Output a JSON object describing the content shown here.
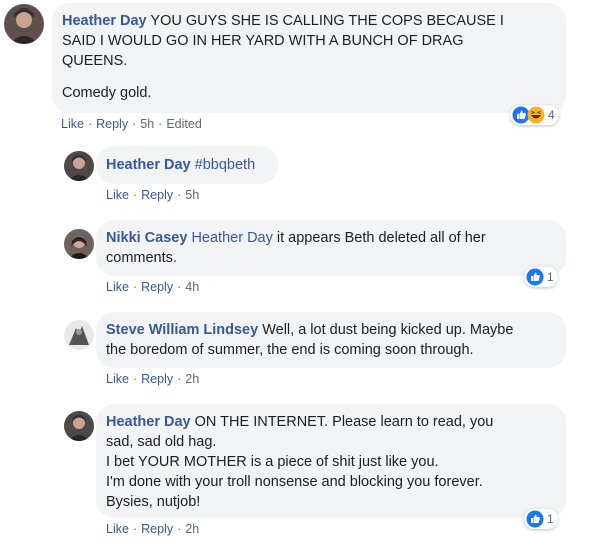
{
  "comments": [
    {
      "author": "Heather Day",
      "text_lines": [
        "YOU GUYS SHE IS CALLING THE COPS BECAUSE I",
        "SAID I WOULD GO IN HER YARD WITH A BUNCH OF DRAG",
        "QUEENS."
      ],
      "text2": "Comedy gold.",
      "like": "Like",
      "reply": "Reply",
      "time": "5h",
      "edited": "Edited",
      "reaction_count": "4"
    },
    {
      "author": "Heather Day",
      "hashtag": "#bbqbeth",
      "like": "Like",
      "reply": "Reply",
      "time": "5h"
    },
    {
      "author": "Nikki Casey",
      "mention": "Heather Day",
      "text_line1": "it appears Beth deleted all of her",
      "text_line2": "comments.",
      "like": "Like",
      "reply": "Reply",
      "time": "4h",
      "reaction_count": "1"
    },
    {
      "author": "Steve William Lindsey",
      "text_line1": "Well, a lot dust being kicked up. Maybe",
      "text_line2": "the boredom of summer, the end is coming soon through.",
      "like": "Like",
      "reply": "Reply",
      "time": "2h"
    },
    {
      "author": "Heather Day",
      "text_line1": "ON THE INTERNET. Please learn to read, you",
      "text_lines": [
        "sad, sad old hag.",
        "I bet YOUR MOTHER is a piece of shit just like you.",
        "I'm done with your troll nonsense and blocking you forever.",
        "Bysies, nutjob!"
      ],
      "like": "Like",
      "reply": "Reply",
      "time": "2h",
      "reaction_count": "1"
    }
  ],
  "colors": {
    "link": "#385898",
    "bubble": "#f2f3f5",
    "meta": "#606770",
    "like_blue": "#1877f2",
    "haha_yellow": "#f7b125"
  },
  "icons": {
    "like": "like-reaction-icon",
    "haha": "haha-reaction-icon"
  }
}
